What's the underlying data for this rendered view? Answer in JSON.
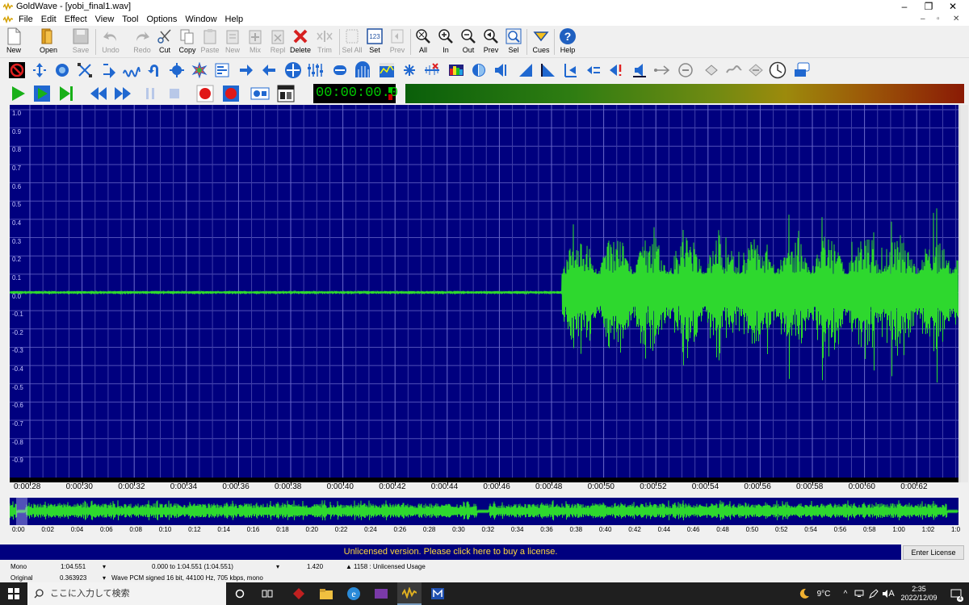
{
  "window": {
    "title": "GoldWave - [yobi_final1.wav]"
  },
  "menu": [
    "File",
    "Edit",
    "Effect",
    "View",
    "Tool",
    "Options",
    "Window",
    "Help"
  ],
  "toolbar": {
    "new": "New",
    "open": "Open",
    "save": "Save",
    "undo": "Undo",
    "redo": "Redo",
    "cut": "Cut",
    "copy": "Copy",
    "paste": "Paste",
    "paste_new": "New",
    "mix": "Mix",
    "replace": "Repl",
    "delete": "Delete",
    "trim": "Trim",
    "sel_all": "Sel All",
    "set": "Set",
    "prev": "Prev",
    "zoom_all": "All",
    "zoom_in": "In",
    "zoom_out": "Out",
    "zoom_prev": "Prev",
    "zoom_sel": "Sel",
    "cues": "Cues",
    "help": "Help",
    "set_icon_text": "123"
  },
  "transport": {
    "time": "00:00:00.0"
  },
  "waveform": {
    "y_labels": [
      "1.0",
      "0.9",
      "0.8",
      "0.7",
      "0.6",
      "0.5",
      "0.4",
      "0.3",
      "0.2",
      "0.1",
      "0.0",
      "-0.1",
      "-0.2",
      "-0.3",
      "-0.4",
      "-0.5",
      "-0.6",
      "-0.7",
      "-0.8",
      "-0.9"
    ],
    "time_labels": [
      "0:00.28",
      "0:00.30",
      "0:00.32",
      "0:00.34",
      "0:00.36",
      "0:00.38",
      "0:00.40",
      "0:00.42",
      "0:00.44",
      "0:00.46",
      "0:00.48",
      "0:00.50",
      "0:00.52",
      "0:00.54",
      "0:00.56",
      "0:00.58",
      "0:00.60",
      "0:00.62"
    ],
    "wave_color": "#2ed82e",
    "bg_color": "#00007f"
  },
  "overview": {
    "time_labels": [
      "0:00",
      "0:02",
      "0:04",
      "0:06",
      "0:08",
      "0:10",
      "0:12",
      "0:14",
      "0:16",
      "0:18",
      "0:20",
      "0:22",
      "0:24",
      "0:26",
      "0:28",
      "0:30",
      "0:32",
      "0:34",
      "0:36",
      "0:38",
      "0:40",
      "0:42",
      "0:44",
      "0:46",
      "0:48",
      "0:50",
      "0:52",
      "0:54",
      "0:56",
      "0:58",
      "1:00",
      "1:02",
      "1:0"
    ]
  },
  "license_bar": {
    "text": "Unlicensed version. Please click here to buy a license.",
    "button": "Enter License"
  },
  "status": {
    "row1": {
      "channel": "Mono",
      "length": "1:04.551",
      "range": "0.000 to 1:04.551 (1:04.551)",
      "zoom": "1.420",
      "usage": "1158 : Unlicensed Usage"
    },
    "row2": {
      "mode": "Original",
      "value": "0.363923",
      "format": "Wave PCM signed 16 bit, 44100 Hz, 705 kbps, mono"
    }
  },
  "taskbar": {
    "search_placeholder": "ここに入力して検索",
    "temperature": "9°C",
    "ime": "A",
    "time": "2:35",
    "date": "2022/12/09",
    "notification_count": "4"
  }
}
